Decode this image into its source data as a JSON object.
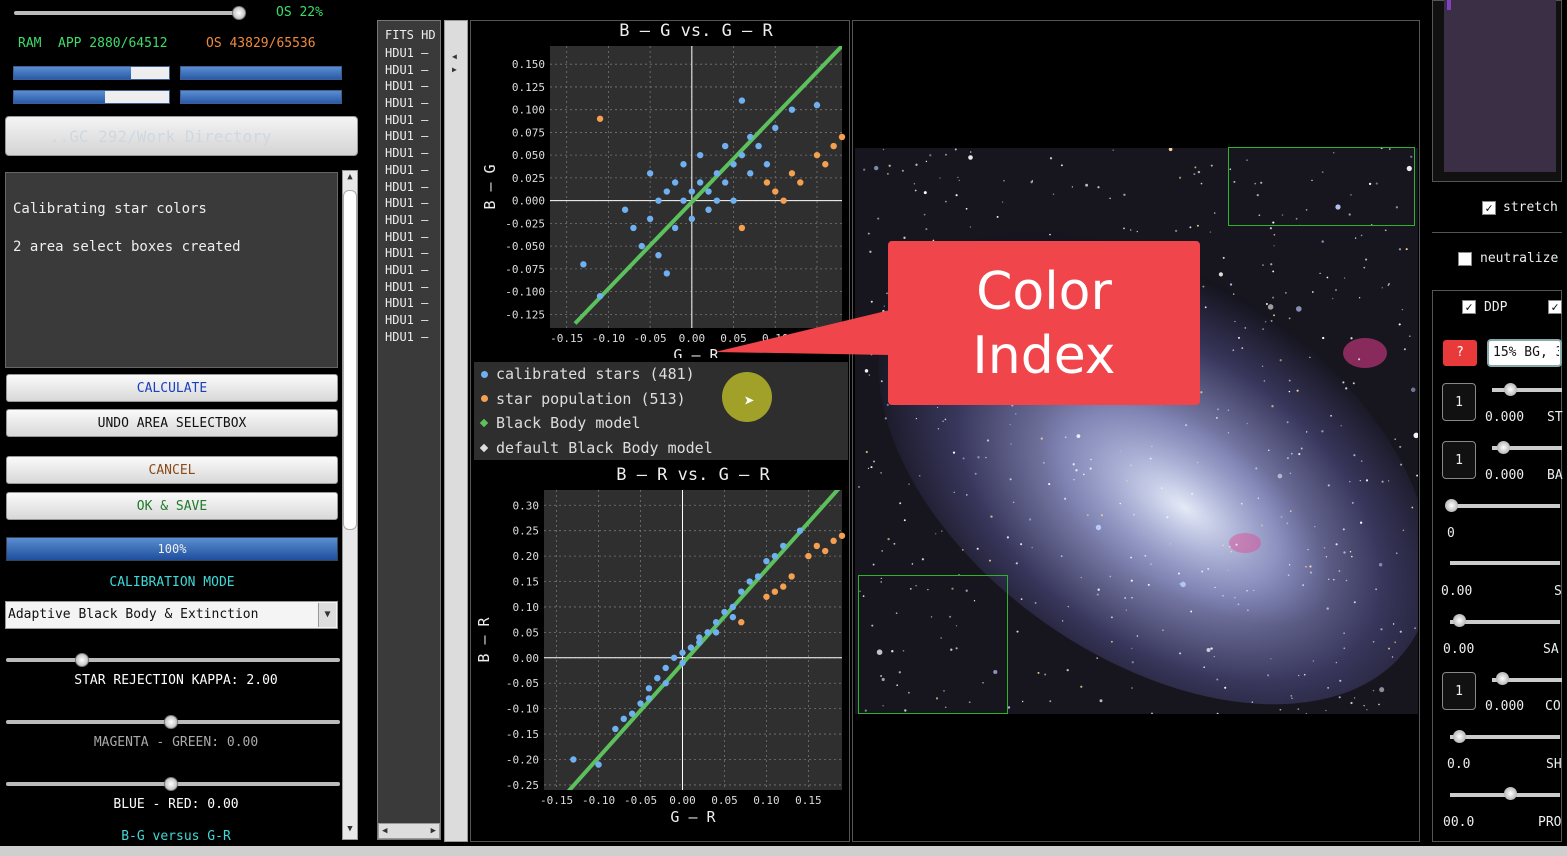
{
  "top_status": {
    "os_percent": "OS 22%",
    "ram_label": "RAM",
    "app_mem": "APP 2880/64512",
    "os_mem": "OS 43829/65536"
  },
  "directory": {
    "label": "..GC 292/Work Directory"
  },
  "console": {
    "lines": [
      "Calibrating star colors",
      "2 area select boxes created"
    ]
  },
  "buttons": {
    "calculate": "CALCULATE",
    "undo": "UNDO AREA SELECTBOX",
    "cancel": "CANCEL",
    "ok_save": "OK & SAVE"
  },
  "progress": {
    "value": 1.0,
    "label": "100%"
  },
  "calibration": {
    "mode_title": "CALIBRATION MODE",
    "mode_value": "Adaptive Black Body & Extinction"
  },
  "sliders": {
    "kappa": {
      "label": "STAR REJECTION KAPPA: 2.00",
      "value": 2.0
    },
    "magenta_green": {
      "label": "MAGENTA - GREEN: 0.00",
      "value": 0.0
    },
    "blue_red": {
      "label": "BLUE - RED: 0.00",
      "value": 0.0
    }
  },
  "bottom_link": "B-G versus G-R",
  "fits_list": {
    "header": "FITS HD",
    "items": [
      "HDU1 –",
      "HDU1 –",
      "HDU1 –",
      "HDU1 –",
      "HDU1 –",
      "HDU1 –",
      "HDU1 –",
      "HDU1 –",
      "HDU1 –",
      "HDU1 –",
      "HDU1 –",
      "HDU1 –",
      "HDU1 –",
      "HDU1 –",
      "HDU1 –",
      "HDU1 –",
      "HDU1 –",
      "HDU1 –"
    ]
  },
  "legend": {
    "items": [
      "calibrated stars (481)",
      "star population (513)",
      "Black Body model",
      "default Black Body model"
    ]
  },
  "colors": {
    "calibrated": "#6fb0f0",
    "population": "#f5a050",
    "bbmodel": "#5cc05c",
    "callout": "#f0454a"
  },
  "chart_data": [
    {
      "type": "scatter",
      "title": "B – G   vs.   G – R",
      "xlabel": "G – R",
      "ylabel": "B – G",
      "xlim": [
        -0.17,
        0.18
      ],
      "ylim": [
        -0.14,
        0.17
      ],
      "xticks": [
        "-0.15",
        "-0.10",
        "-0.05",
        "0.00",
        "0.05",
        "0.10",
        "0.15"
      ],
      "xtick_values": [
        -0.15,
        -0.1,
        -0.05,
        0.0,
        0.05,
        0.1,
        0.15
      ],
      "yticks": [
        "0.150",
        "0.125",
        "0.100",
        "0.075",
        "0.050",
        "0.025",
        "0.000",
        "-0.025",
        "-0.050",
        "-0.075",
        "-0.100",
        "-0.125"
      ],
      "ytick_values": [
        0.15,
        0.125,
        0.1,
        0.075,
        0.05,
        0.025,
        0.0,
        -0.025,
        -0.05,
        -0.075,
        -0.1,
        -0.125
      ],
      "grid": true,
      "model_line": [
        [
          -0.14,
          -0.135
        ],
        [
          0.18,
          0.17
        ]
      ],
      "series": [
        {
          "name": "calibrated stars (481)",
          "points": [
            [
              -0.13,
              -0.07
            ],
            [
              -0.11,
              -0.105
            ],
            [
              -0.07,
              -0.03
            ],
            [
              -0.05,
              -0.02
            ],
            [
              -0.04,
              0.0
            ],
            [
              -0.03,
              0.01
            ],
            [
              -0.02,
              0.02
            ],
            [
              -0.01,
              0.0
            ],
            [
              0.0,
              0.01
            ],
            [
              0.01,
              0.02
            ],
            [
              0.02,
              0.01
            ],
            [
              0.03,
              0.03
            ],
            [
              0.04,
              0.02
            ],
            [
              0.05,
              0.04
            ],
            [
              0.06,
              0.05
            ],
            [
              0.07,
              0.03
            ],
            [
              0.08,
              0.06
            ],
            [
              0.1,
              0.08
            ],
            [
              0.12,
              0.1
            ],
            [
              0.15,
              0.105
            ],
            [
              -0.06,
              -0.05
            ],
            [
              -0.04,
              -0.06
            ],
            [
              -0.02,
              -0.03
            ],
            [
              0.0,
              -0.02
            ],
            [
              0.02,
              -0.01
            ],
            [
              0.03,
              0.0
            ],
            [
              -0.01,
              0.04
            ],
            [
              0.01,
              0.05
            ],
            [
              0.05,
              0.0
            ],
            [
              0.07,
              0.07
            ],
            [
              -0.05,
              0.03
            ],
            [
              0.09,
              0.04
            ],
            [
              0.06,
              0.11
            ],
            [
              -0.03,
              -0.08
            ],
            [
              0.04,
              0.06
            ],
            [
              -0.08,
              -0.01
            ]
          ]
        },
        {
          "name": "star population (513)",
          "points": [
            [
              -0.11,
              0.09
            ],
            [
              0.09,
              0.02
            ],
            [
              0.1,
              0.01
            ],
            [
              0.12,
              0.03
            ],
            [
              0.15,
              0.05
            ],
            [
              0.16,
              0.04
            ],
            [
              0.17,
              0.06
            ],
            [
              0.06,
              -0.03
            ],
            [
              0.11,
              0.0
            ],
            [
              0.13,
              0.02
            ],
            [
              0.18,
              0.07
            ]
          ]
        }
      ]
    },
    {
      "type": "scatter",
      "title": "B – R   vs.   G – R",
      "xlabel": "G – R",
      "ylabel": "B – R",
      "xlim": [
        -0.165,
        0.19
      ],
      "ylim": [
        -0.26,
        0.33
      ],
      "xticks": [
        "-0.15",
        "-0.10",
        "-0.05",
        "0.00",
        "0.05",
        "0.10",
        "0.15"
      ],
      "xtick_values": [
        -0.15,
        -0.1,
        -0.05,
        0.0,
        0.05,
        0.1,
        0.15
      ],
      "yticks": [
        "0.30",
        "0.25",
        "0.20",
        "0.15",
        "0.10",
        "0.05",
        "0.00",
        "-0.05",
        "-0.10",
        "-0.15",
        "-0.20",
        "-0.25"
      ],
      "ytick_values": [
        0.3,
        0.25,
        0.2,
        0.15,
        0.1,
        0.05,
        0.0,
        -0.05,
        -0.1,
        -0.15,
        -0.2,
        -0.25
      ],
      "grid": true,
      "model_line": [
        [
          -0.14,
          -0.27
        ],
        [
          0.19,
          0.34
        ]
      ],
      "series": [
        {
          "name": "calibrated stars (481)",
          "points": [
            [
              -0.13,
              -0.2
            ],
            [
              -0.1,
              -0.21
            ],
            [
              -0.07,
              -0.12
            ],
            [
              -0.05,
              -0.09
            ],
            [
              -0.04,
              -0.06
            ],
            [
              -0.03,
              -0.04
            ],
            [
              -0.02,
              -0.02
            ],
            [
              -0.01,
              0.0
            ],
            [
              0.0,
              0.01
            ],
            [
              0.01,
              0.02
            ],
            [
              0.02,
              0.04
            ],
            [
              0.03,
              0.05
            ],
            [
              0.04,
              0.07
            ],
            [
              0.05,
              0.09
            ],
            [
              0.06,
              0.1
            ],
            [
              0.07,
              0.13
            ],
            [
              0.08,
              0.15
            ],
            [
              0.1,
              0.19
            ],
            [
              0.12,
              0.22
            ],
            [
              0.14,
              0.25
            ],
            [
              -0.06,
              -0.11
            ],
            [
              -0.04,
              -0.08
            ],
            [
              -0.02,
              -0.05
            ],
            [
              0.0,
              -0.01
            ],
            [
              0.02,
              0.03
            ],
            [
              0.04,
              0.05
            ],
            [
              -0.08,
              -0.14
            ],
            [
              0.06,
              0.08
            ],
            [
              0.09,
              0.16
            ],
            [
              0.11,
              0.2
            ]
          ]
        },
        {
          "name": "star population (513)",
          "points": [
            [
              0.1,
              0.12
            ],
            [
              0.11,
              0.13
            ],
            [
              0.13,
              0.16
            ],
            [
              0.15,
              0.2
            ],
            [
              0.16,
              0.22
            ],
            [
              0.18,
              0.23
            ],
            [
              0.17,
              0.21
            ],
            [
              0.19,
              0.24
            ],
            [
              0.07,
              0.07
            ],
            [
              0.12,
              0.14
            ]
          ]
        }
      ]
    }
  ],
  "callout": {
    "line1": "Color",
    "line2": "Index"
  },
  "right_panel": {
    "stretch": "stretch",
    "neutralize": "neutralize",
    "ddp": "DDP",
    "bg_field": "15% BG, 3",
    "question": "?",
    "rows": [
      {
        "num": "1",
        "value": "0.000",
        "tag": "ST"
      },
      {
        "num": "1",
        "value": "0.000",
        "tag": "BA"
      },
      {
        "value": "0",
        "tag": ""
      },
      {
        "value": "0.00",
        "tag": "S"
      },
      {
        "value": "0.00",
        "tag": "SA"
      },
      {
        "num": "1",
        "value": "0.000",
        "tag": "CO"
      },
      {
        "value": "0.0",
        "tag": "SH"
      },
      {
        "value": "00.0",
        "tag": "PRO"
      }
    ]
  }
}
